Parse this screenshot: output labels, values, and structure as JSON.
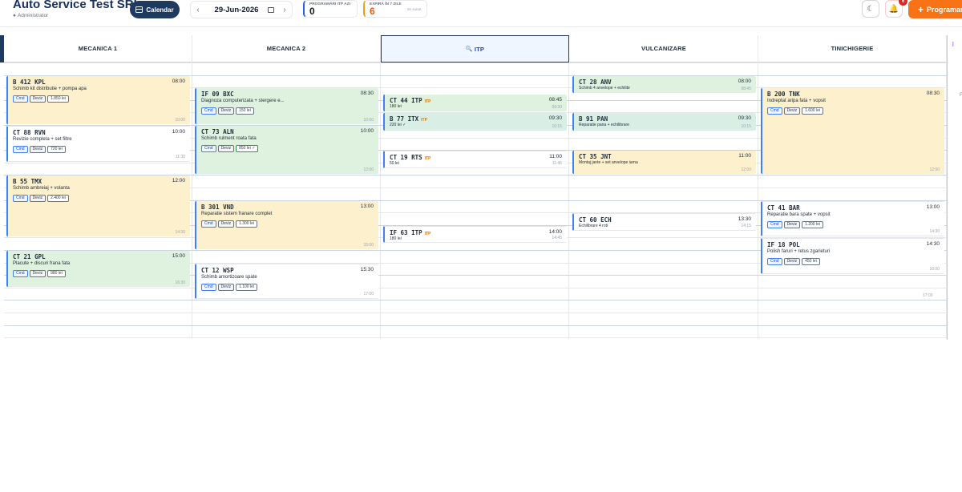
{
  "header": {
    "company": "Auto Service Test SRL",
    "role": "Administrator",
    "calendar_label": "Calendar",
    "date": "29-Jun-2026",
    "prev": "‹",
    "next": "›",
    "stats": [
      {
        "label": "PROGRAMĂRI ITP AZI",
        "value": "0",
        "sub": ""
      },
      {
        "label": "EXPIRĂ ÎN 7 ZILE",
        "value": "6",
        "sub": "de sunat"
      }
    ],
    "notifications": "6",
    "new_button": "Programare",
    "theme_icon": "moon-icon",
    "bell_icon": "bell-icon"
  },
  "columns": [
    {
      "name": "MECANICA 1",
      "icon": ""
    },
    {
      "name": "MECANICA 2",
      "icon": ""
    },
    {
      "name": "ITP",
      "icon": "magnifier-icon"
    },
    {
      "name": "VULCANIZARE",
      "icon": ""
    },
    {
      "name": "TINICHIGERIE",
      "icon": ""
    }
  ],
  "right_strip": {
    "tag": "Î"
  },
  "appointments": [
    {
      "col": 0,
      "plate": "B 412 KPL",
      "start": "08:00",
      "end": "10:00",
      "desc": "Schimb kit distributie + pompa apa",
      "price": "1.850 lei",
      "color": "orange",
      "itp": false
    },
    {
      "col": 0,
      "plate": "CT 88 RVN",
      "start": "10:00",
      "end": "11:30",
      "desc": "Revizie completa + set filtre",
      "price": "720 lei",
      "color": "white",
      "itp": false
    },
    {
      "col": 0,
      "plate": "B 55 TMX",
      "start": "12:00",
      "end": "14:30",
      "desc": "Schimb ambreiaj + volanta",
      "price": "2.400 lei",
      "color": "orange",
      "itp": false
    },
    {
      "col": 0,
      "plate": "CT 21 GPL",
      "start": "15:00",
      "end": "16:30",
      "desc": "Placute + discuri frana fata",
      "price": "980 lei",
      "color": "green",
      "itp": false
    },
    {
      "col": 1,
      "plate": "IF 09 BXC",
      "start": "08:30",
      "end": "10:00",
      "desc": "Diagnoza computerizata + stergere e...",
      "price": "150 lei",
      "color": "green",
      "itp": false
    },
    {
      "col": 1,
      "plate": "CT 73 ALN",
      "start": "10:00",
      "end": "12:00",
      "desc": "Schimb rulment roata fata",
      "price": "850 lei ✓",
      "color": "green",
      "itp": false
    },
    {
      "col": 1,
      "plate": "B 301 VND",
      "start": "13:00",
      "end": "15:00",
      "desc": "Reparatie sistem franare complet",
      "price": "1.300 lei",
      "color": "orange",
      "itp": false
    },
    {
      "col": 1,
      "plate": "CT 12 WSP",
      "start": "15:30",
      "end": "17:00",
      "desc": "Schimb amortizoare spate",
      "price": "1.100 lei",
      "color": "white",
      "itp": false
    },
    {
      "col": 2,
      "plate": "CT 44 ITP",
      "start": "08:45",
      "end": "09:30",
      "desc": "180 lei",
      "price": "",
      "color": "green",
      "itp": true
    },
    {
      "col": 2,
      "plate": "B 77 ITX",
      "start": "09:30",
      "end": "10:15",
      "desc": "220 lei ✓",
      "price": "",
      "color": "teal",
      "itp": true
    },
    {
      "col": 2,
      "plate": "CT 19 RTS",
      "start": "11:00",
      "end": "11:45",
      "desc": "50 lei",
      "price": "",
      "color": "white",
      "itp": true
    },
    {
      "col": 2,
      "plate": "IF 63 ITP",
      "start": "14:00",
      "end": "14:45",
      "desc": "180 lei",
      "price": "",
      "color": "white",
      "itp": true
    },
    {
      "col": 3,
      "plate": "CT 28 ANV",
      "start": "08:00",
      "end": "08:45",
      "desc": "Schimb 4 anvelope + echilibr",
      "price": "",
      "color": "green",
      "itp": false
    },
    {
      "col": 3,
      "plate": "B 91 PAN",
      "start": "09:30",
      "end": "10:15",
      "desc": "Reparatie pana + echilibrare",
      "price": "",
      "color": "teal",
      "itp": false
    },
    {
      "col": 3,
      "plate": "CT 35 JNT",
      "start": "11:00",
      "end": "12:00",
      "desc": "Montaj jante + set anvelope iarna",
      "price": "350 lei",
      "color": "orange",
      "itp": false
    },
    {
      "col": 3,
      "plate": "CT 60 ECH",
      "start": "13:30",
      "end": "14:15",
      "desc": "Echilibrare 4 roti",
      "price": "",
      "color": "white",
      "itp": false
    },
    {
      "col": 4,
      "plate": "B 200 TNK",
      "start": "08:30",
      "end": "12:00",
      "desc": "Indreptat aripa fata + vopsit",
      "price": "1.600 lei",
      "color": "orange",
      "itp": false
    },
    {
      "col": 4,
      "plate": "CT 41 BAR",
      "start": "13:00",
      "end": "14:30",
      "desc": "Reparatie bara spate + vopsit",
      "price": "1.200 lei",
      "color": "white",
      "itp": false
    },
    {
      "col": 4,
      "plate": "IF 18 POL",
      "start": "14:30",
      "end": "16:00",
      "desc": "Polish faruri + retus zgarieturi",
      "price": "450 lei",
      "color": "white",
      "itp": false
    },
    {
      "col": 4,
      "plate": "",
      "start": "",
      "end": "17:00",
      "desc": "",
      "price": "",
      "color": "none",
      "itp": false
    }
  ],
  "buttons": {
    "cmd": "Cmd",
    "deviz": "Deviz"
  },
  "itp_label": "ITP"
}
